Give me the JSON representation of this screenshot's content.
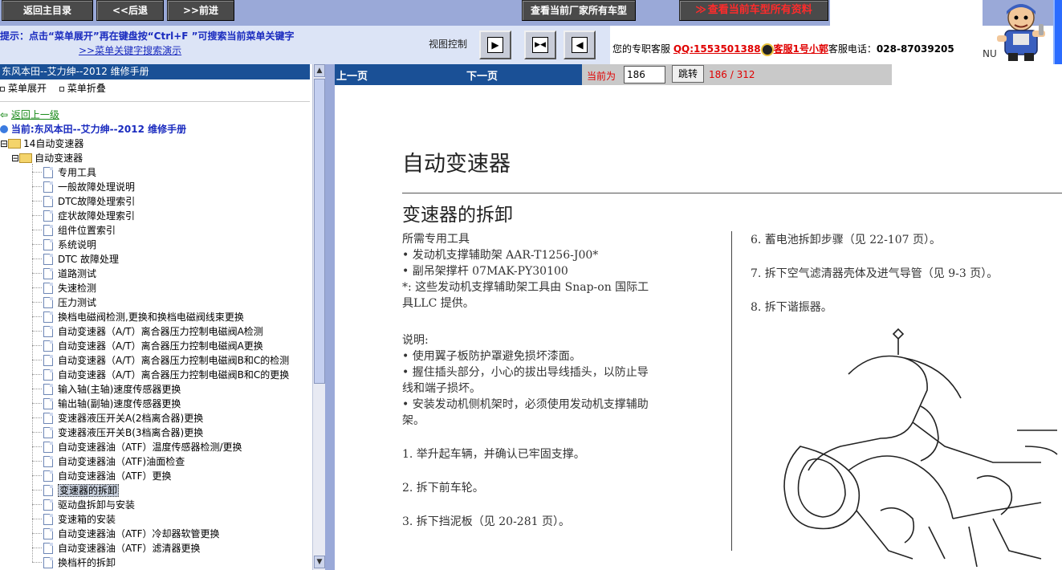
{
  "toolbar": {
    "home": "返回主目录",
    "back": "<<后退",
    "forward": ">>前进",
    "maker_models": "查看当前厂家所有车型",
    "model_data": "查看当前车型所有资料"
  },
  "hint": {
    "text": "提示：点击“菜单展开”再在键盘按“Ctrl+F ”可搜索当前菜单关键字",
    "link": ">>菜单关键字搜索演示"
  },
  "view_control": {
    "label": "视图控制",
    "buttons": [
      "right-arrow",
      "split",
      "left-arrow"
    ]
  },
  "service": {
    "prefix": "您的专职客服",
    "qq": "QQ:1553501388",
    "agent": "客服1号小郭",
    "phone_label": "客服电话：",
    "phone": "028-87039205"
  },
  "nu_text": "NU",
  "left": {
    "title": "东风本田--艾力绅--2012 维修手册",
    "expand": "菜单展开",
    "collapse": "菜单折叠",
    "back_link": "返回上一级",
    "current": "当前:东风本田--艾力绅--2012 维修手册",
    "folder1": "14自动变速器",
    "folder2": "自动变速器",
    "items": [
      "专用工具",
      "一般故障处理说明",
      "DTC故障处理索引",
      "症状故障处理索引",
      "组件位置索引",
      "系统说明",
      "DTC 故障处理",
      "道路测试",
      "失速检测",
      "压力测试",
      "换档电磁阀检测,更换和换档电磁阀线束更换",
      "自动变速器（A/T）离合器压力控制电磁阀A检测",
      "自动变速器（A/T）离合器压力控制电磁阀A更换",
      "自动变速器（A/T）离合器压力控制电磁阀B和C的检测",
      "自动变速器（A/T）离合器压力控制电磁阀B和C的更换",
      "输入轴(主轴)速度传感器更换",
      "输出轴(副轴)速度传感器更换",
      "变速器液压开关A(2档离合器)更换",
      "变速器液压开关B(3档离合器)更换",
      "自动变速器油（ATF）温度传感器检测/更换",
      "自动变速器油（ATF)油面检查",
      "自动变速器油（ATF）更换",
      "变速器的拆卸",
      "驱动盘拆卸与安装",
      "变速箱的安装",
      "自动变速器油（ATF）冷却器软管更换",
      "自动变速器油（ATF）滤清器更换",
      "换档杆的拆卸"
    ],
    "selected_index": 22
  },
  "nav": {
    "prev": "上一页",
    "next": "下一页",
    "current_label": "当前为",
    "page_value": "186",
    "jump": "跳转",
    "page_count": "186 / 312"
  },
  "doc": {
    "h1": "自动变速器",
    "h2": "变速器的拆卸",
    "tools_title": "所需专用工具",
    "tool1": "• 发动机支撑辅助架 AAR-T1256-J00*",
    "tool2": "• 副吊架撑杆 07MAK-PY30100",
    "tool_note1": "*: 这些发动机支撑辅助架工具由 Snap-on 国际工",
    "tool_note2": "具LLC 提供。",
    "notes_title": "说明:",
    "note1": "• 使用翼子板防护罩避免损坏漆面。",
    "note2a": "• 握住插头部分，小心的拔出导线插头，以防止导",
    "note2b": "  线和端子损坏。",
    "note3a": "• 安装发动机侧机架时，必须使用发动机支撑辅助",
    "note3b": "  架。",
    "step1": "1. 举升起车辆，并确认已牢固支撑。",
    "step2": "2. 拆下前车轮。",
    "step3": "3. 拆下挡泥板（见 20-281 页）。",
    "step6": "6. 蓄电池拆卸步骤（见 22-107 页）。",
    "step7": "7. 拆下空气滤清器壳体及进气导管（见 9-3 页）。",
    "step8": "8. 拆下谐振器。"
  },
  "colors": {
    "toolbar_bg": "#9aa9d8",
    "nav_blue": "#1a5096",
    "button_dark": "#4a4a4a",
    "accent_red": "#e00000",
    "hint_blue": "#1a2bbf"
  }
}
